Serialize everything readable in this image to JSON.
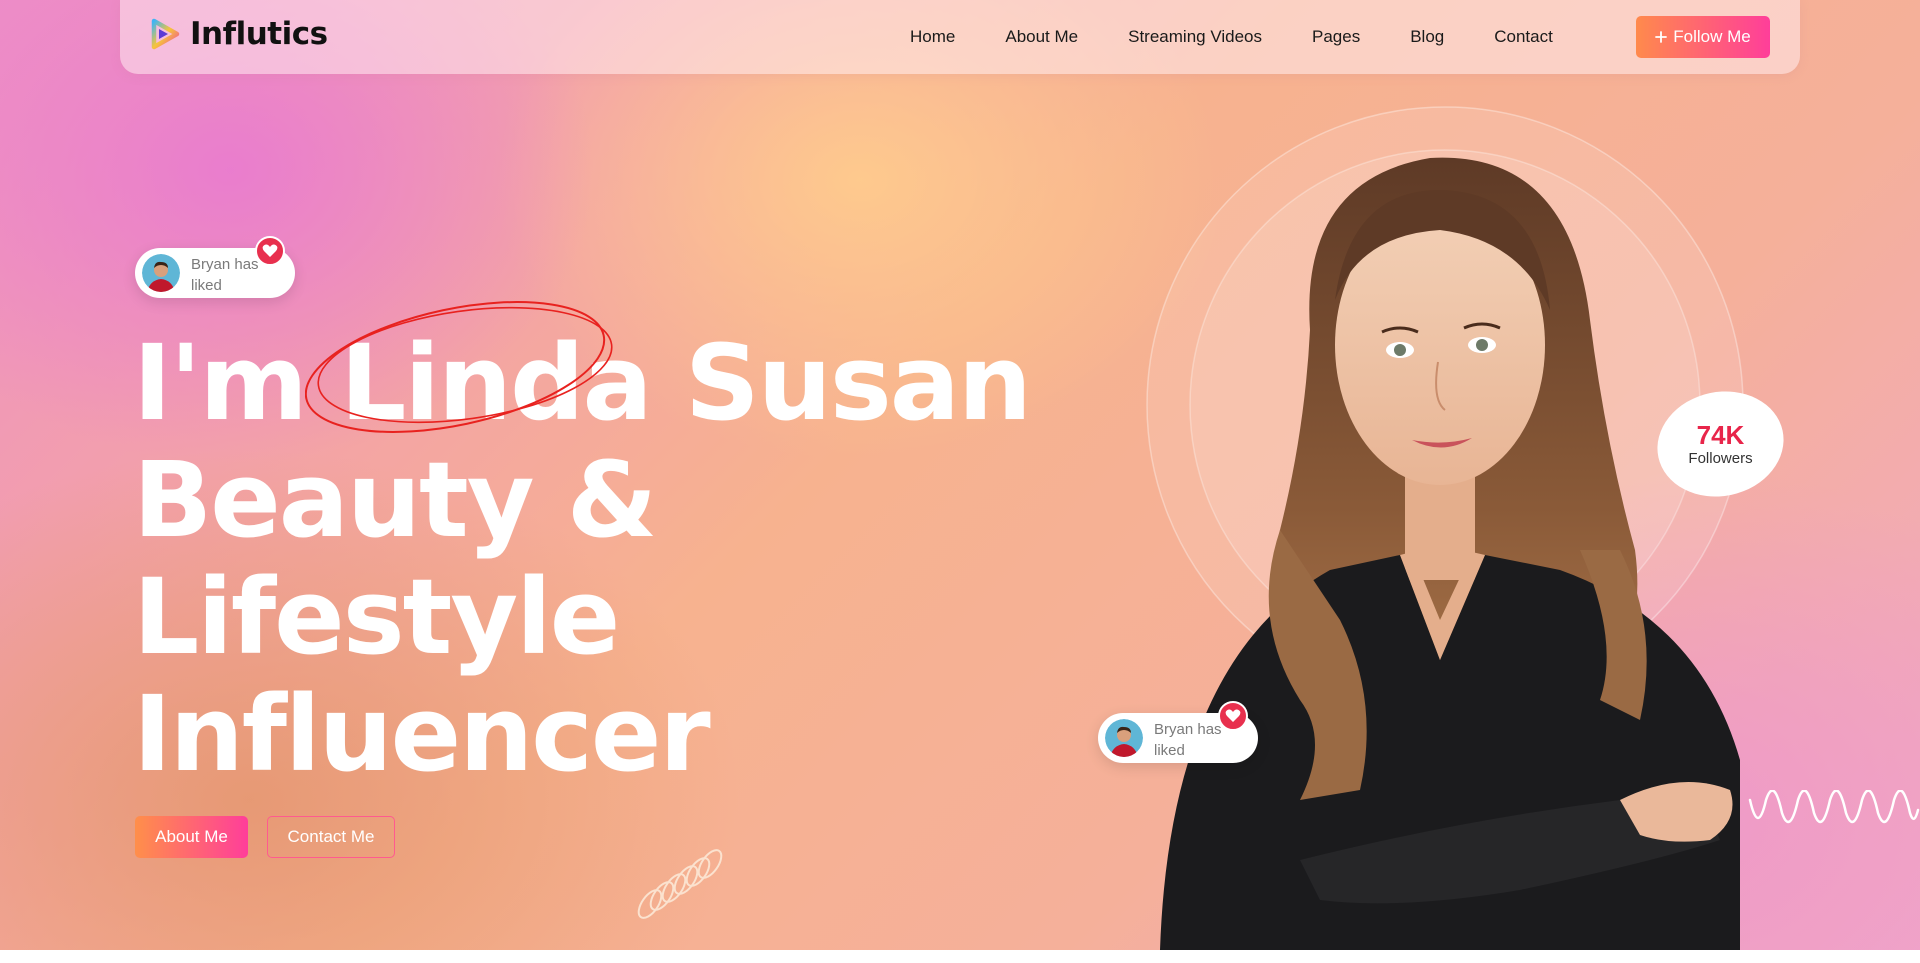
{
  "brand": {
    "name": "Influtics"
  },
  "nav": {
    "links": [
      "Home",
      "About Me",
      "Streaming Videos",
      "Pages",
      "Blog",
      "Contact"
    ],
    "follow_label": "Follow Me",
    "follow_icon": "plus-icon"
  },
  "like_cards": [
    {
      "text": "Bryan has liked",
      "icon": "heart-icon"
    },
    {
      "text": "Bryan has liked",
      "icon": "heart-icon"
    }
  ],
  "hero": {
    "headline_lines": [
      "I'm Linda Susan",
      "Beauty &",
      "Lifestyle",
      "Influencer"
    ],
    "about_button": "About Me",
    "contact_button": "Contact Me"
  },
  "followers": {
    "count": "74K",
    "label": "Followers"
  },
  "colors": {
    "accent_gradient_start": "#ff8a4c",
    "accent_gradient_end": "#ff3e9a",
    "heart": "#e8304e",
    "followers_count": "#e8254a"
  }
}
